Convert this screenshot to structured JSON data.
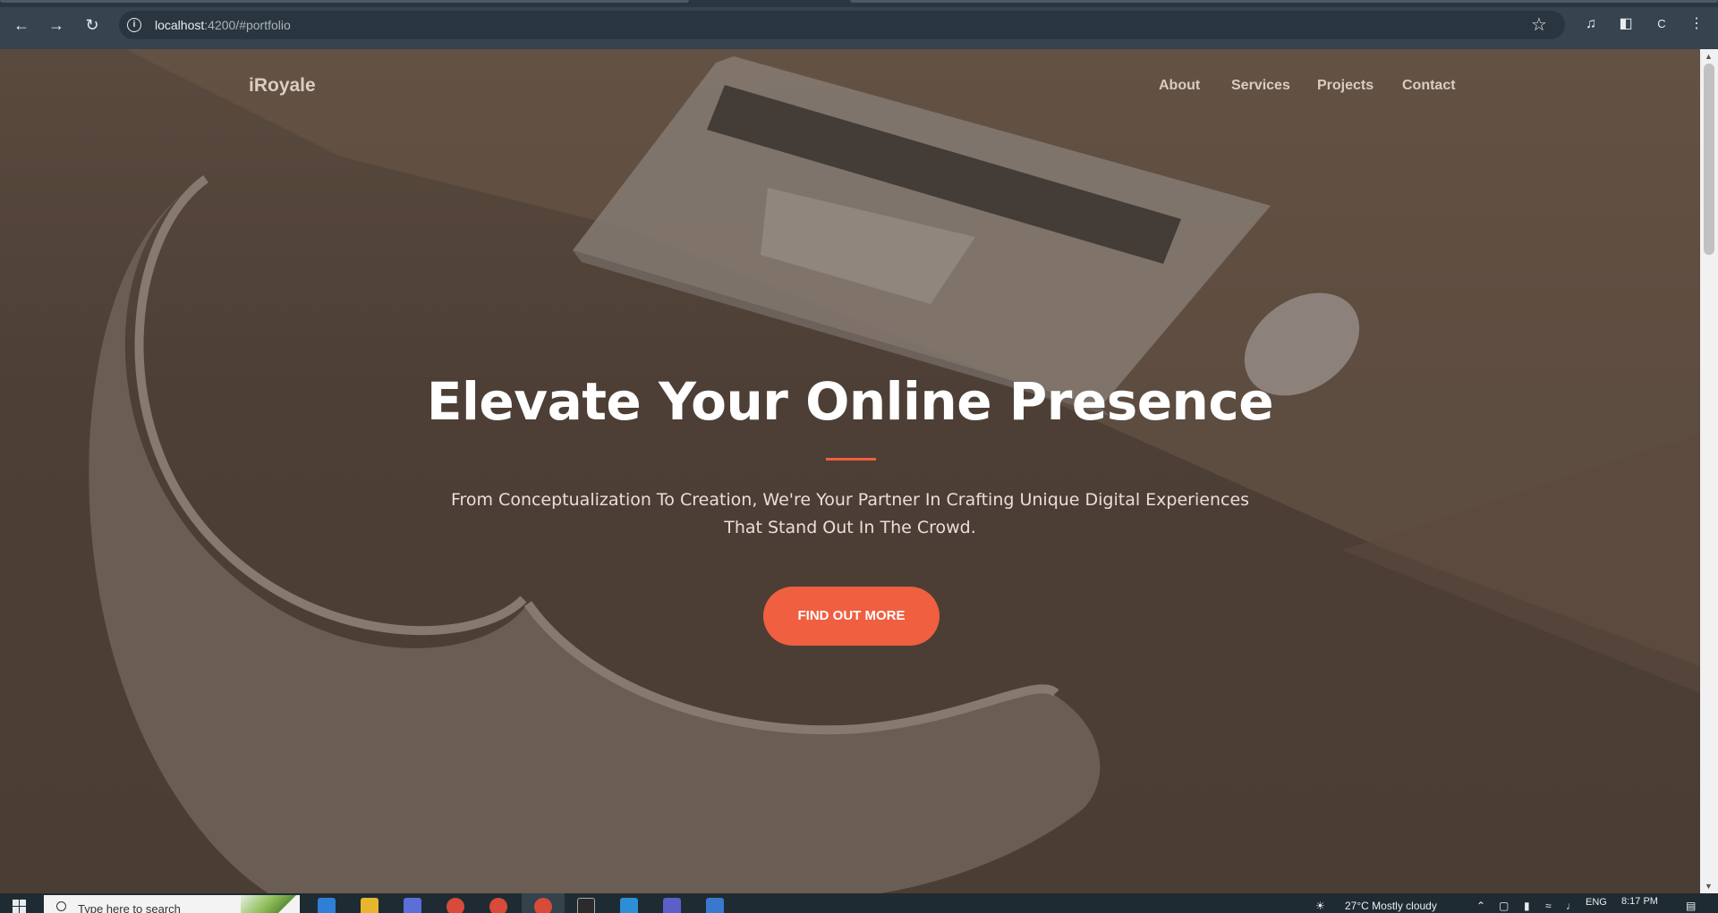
{
  "browser": {
    "url_host": "localhost",
    "url_rest": ":4200/#portfolio",
    "profile_initial": "C"
  },
  "site": {
    "brand": "iRoyale",
    "nav": [
      {
        "label": "About"
      },
      {
        "label": "Services"
      },
      {
        "label": "Projects"
      },
      {
        "label": "Contact"
      }
    ]
  },
  "hero": {
    "title": "Elevate Your Online Presence",
    "subtitle_line1": "From Conceptualization To Creation, We're Your Partner In Crafting Unique Digital Experiences",
    "subtitle_line2": "That Stand Out In The Crowd.",
    "cta_label": "FIND OUT MORE"
  },
  "taskbar": {
    "search_placeholder": "Type here to search",
    "weather": "27°C  Mostly cloudy",
    "language": "ENG",
    "time": "8:17 PM"
  },
  "colors": {
    "accent": "#f05f40",
    "overlay": "#4b3e35",
    "chrome": "#35444f"
  },
  "icons": [
    "back-arrow-icon",
    "forward-arrow-icon",
    "reload-icon",
    "info-icon",
    "star-icon",
    "media-icon",
    "side-panel-icon",
    "more-icon",
    "windows-icon",
    "search-icon"
  ]
}
